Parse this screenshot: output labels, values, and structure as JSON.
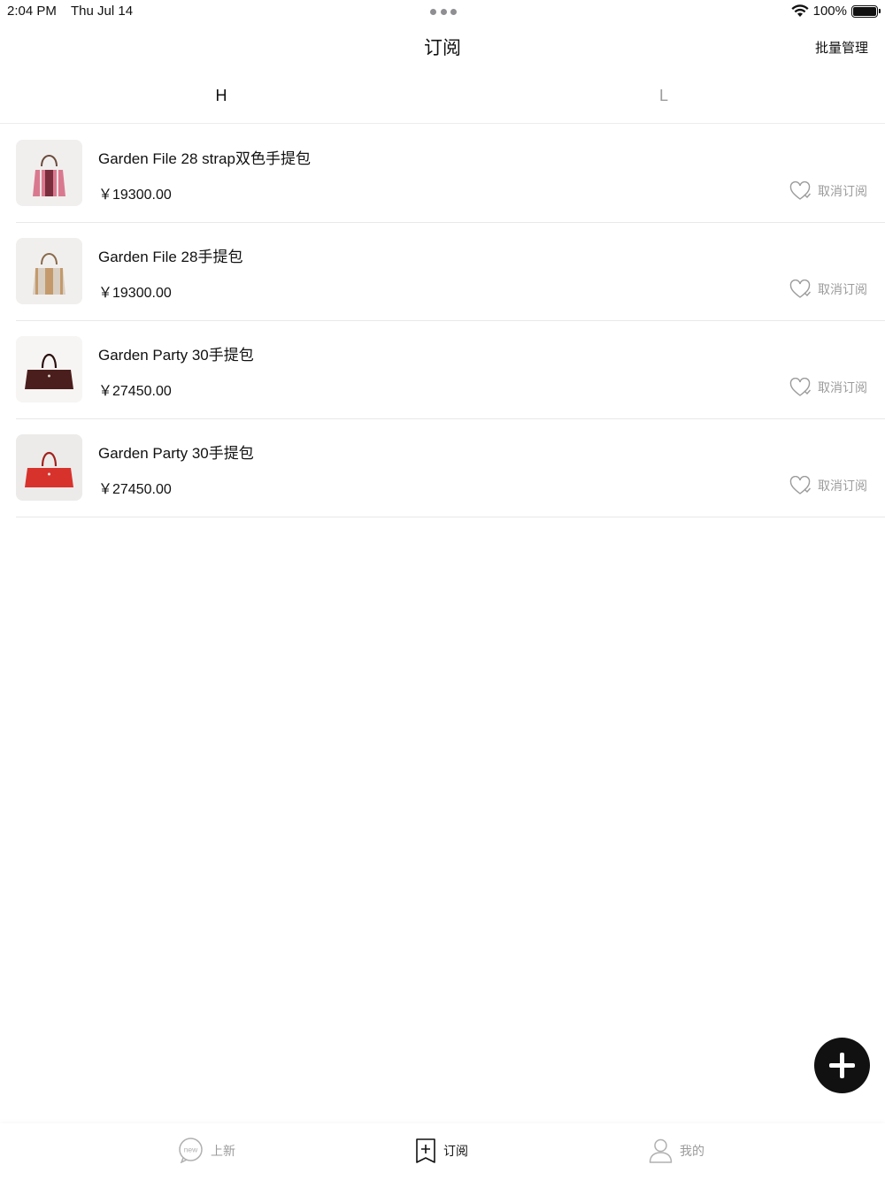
{
  "status_bar": {
    "time": "2:04 PM",
    "date": "Thu Jul 14",
    "battery": "100%",
    "battery_level": 1.0
  },
  "header": {
    "title": "订阅",
    "action_label": "批量管理"
  },
  "tabs": [
    {
      "label": "H",
      "active": true
    },
    {
      "label": "L",
      "active": false
    }
  ],
  "items": [
    {
      "name": "Garden File 28 strap双色手提包",
      "price": "￥19300.00",
      "action": "取消订阅",
      "thumb_color": "#d9798f"
    },
    {
      "name": "Garden File 28手提包",
      "price": "￥19300.00",
      "action": "取消订阅",
      "thumb_color": "#d8cfc2"
    },
    {
      "name": "Garden Party 30手提包",
      "price": "￥27450.00",
      "action": "取消订阅",
      "thumb_color": "#4a1e1c"
    },
    {
      "name": "Garden Party 30手提包",
      "price": "￥27450.00",
      "action": "取消订阅",
      "thumb_color": "#d8322c"
    }
  ],
  "tab_bar": {
    "new_label": "上新",
    "new_icon_text": "new",
    "subscribe_label": "订阅",
    "me_label": "我的"
  },
  "colors": {
    "accent": "#111111",
    "muted": "#9b9b9b",
    "divider": "#e8e8e8"
  }
}
